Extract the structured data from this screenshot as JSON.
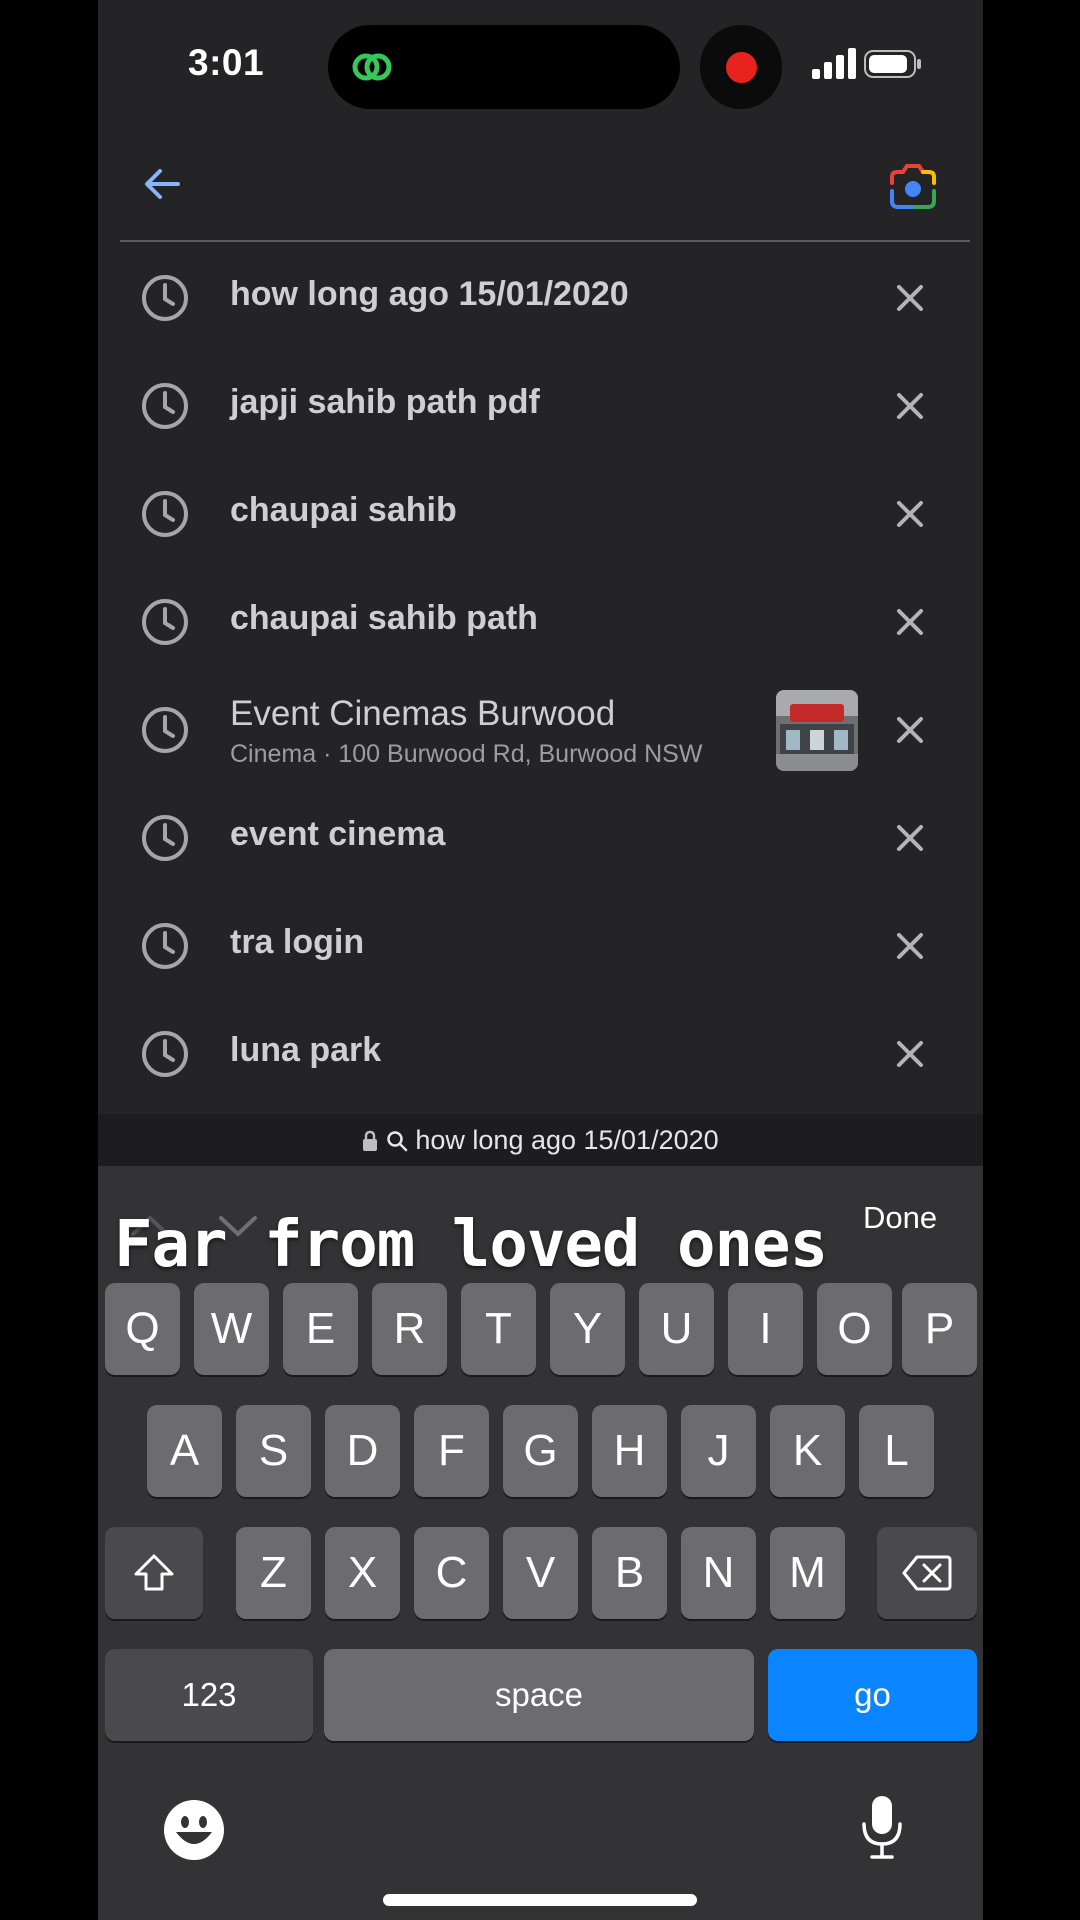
{
  "status": {
    "time": "3:01"
  },
  "colors": {
    "accent_blue": "#0a84ff",
    "recording_red": "#e8221e",
    "background": "#242427"
  },
  "header": {
    "back_icon": "arrow-left-icon",
    "lens_icon": "camera-lens-icon"
  },
  "suggestions": [
    {
      "text": "how long ago 15/01/2020"
    },
    {
      "text": "japji sahib path pdf"
    },
    {
      "text": "chaupai sahib"
    },
    {
      "text": "chaupai sahib path"
    },
    {
      "title": "Event Cinemas Burwood",
      "subtitle": "Cinema · 100 Burwood Rd, Burwood NSW"
    },
    {
      "text": "event cinema"
    },
    {
      "text": "tra login"
    },
    {
      "text": "luna park"
    }
  ],
  "url_bar": {
    "text": "how long ago 15/01/2020"
  },
  "keyboard": {
    "done_label": "Done",
    "row1": [
      "Q",
      "W",
      "E",
      "R",
      "T",
      "Y",
      "U",
      "I",
      "O",
      "P"
    ],
    "row2": [
      "A",
      "S",
      "D",
      "F",
      "G",
      "H",
      "J",
      "K",
      "L"
    ],
    "row3": [
      "Z",
      "X",
      "C",
      "V",
      "B",
      "N",
      "M"
    ],
    "numbers_label": "123",
    "space_label": "space",
    "go_label": "go"
  },
  "overlay_caption": "Far from loved ones"
}
